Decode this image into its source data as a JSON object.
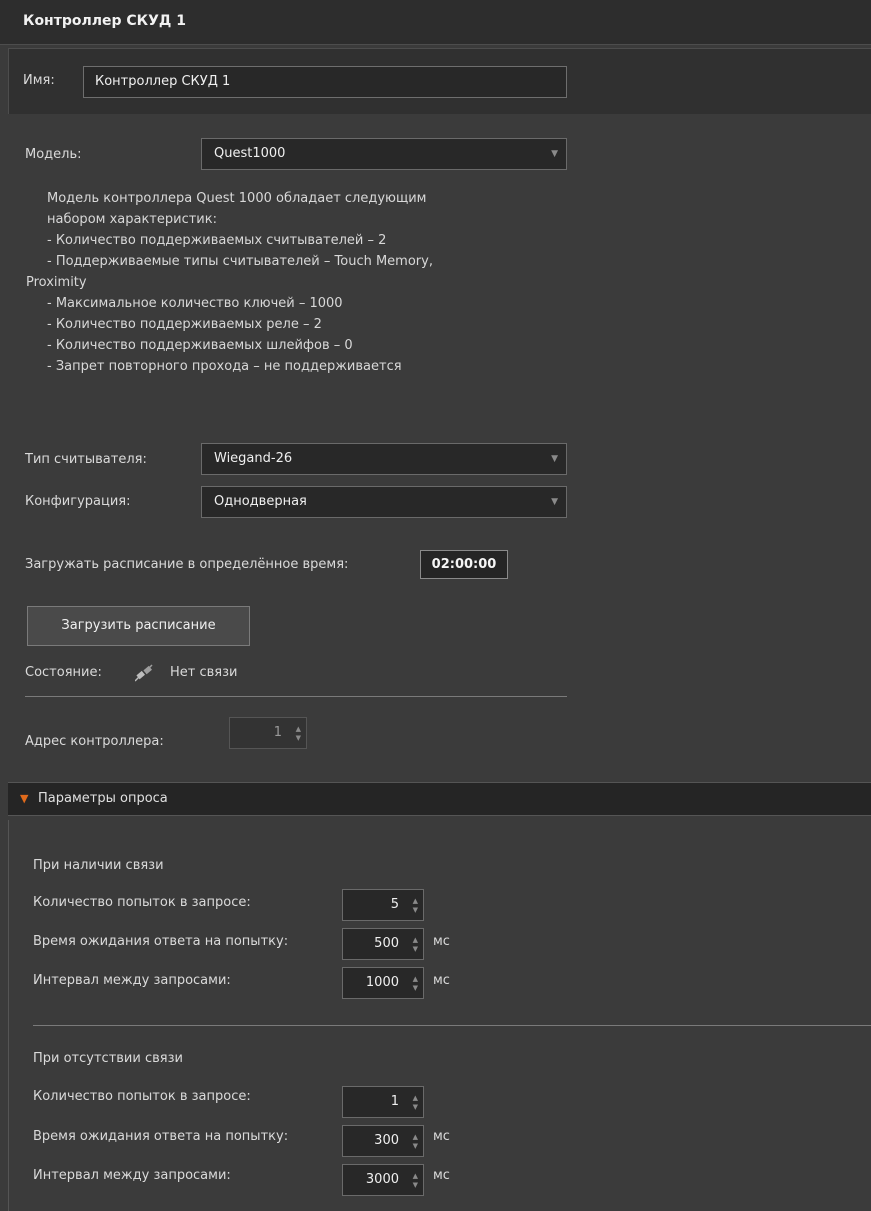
{
  "header": {
    "title": "Контроллер СКУД 1"
  },
  "name_row": {
    "label": "Имя:",
    "value": "Контроллер СКУД 1"
  },
  "model": {
    "label": "Модель:",
    "value": "Quest1000"
  },
  "description": [
    "Модель контроллера Quest 1000 обладает следующим",
    "набором характеристик:",
    " - Количество поддерживаемых считывателей – 2",
    " - Поддерживаемые типы считывателей – Touch Memory,",
    "Proximity",
    " - Максимальное количество ключей – 1000",
    " - Количество поддерживаемых реле – 2",
    " - Количество поддерживаемых шлейфов – 0",
    " - Запрет повторного прохода – не поддерживается"
  ],
  "reader_type": {
    "label": "Тип считывателя:",
    "value": "Wiegand-26"
  },
  "configuration": {
    "label": "Конфигурация:",
    "value": "Однодверная"
  },
  "schedule": {
    "label": "Загружать расписание в определённое время:",
    "time": "02:00:00"
  },
  "upload_button": "Загрузить расписание",
  "status": {
    "label": "Состояние:",
    "value": "Нет связи",
    "icon": "plug-disconnected-icon"
  },
  "address": {
    "label": "Адрес контроллера:",
    "value": "1"
  },
  "polling": {
    "title": "Параметры опроса",
    "connected": {
      "title": "При наличии связи",
      "attempts_label": "Количество попыток в запросе:",
      "attempts": "5",
      "timeout_label": "Время ожидания ответа на попытку:",
      "timeout": "500",
      "timeout_unit": "мс",
      "interval_label": "Интервал между запросами:",
      "interval": "1000",
      "interval_unit": "мс"
    },
    "disconnected": {
      "title": "При отсутствии связи",
      "attempts_label": "Количество попыток в запросе:",
      "attempts": "1",
      "timeout_label": "Время ожидания ответа на попытку:",
      "timeout": "300",
      "timeout_unit": "мс",
      "interval_label": "Интервал между запросами:",
      "interval": "3000",
      "interval_unit": "мс"
    }
  },
  "colors": {
    "accent": "#e06a1b",
    "background": "#3b3b3b",
    "field": "#282828"
  }
}
